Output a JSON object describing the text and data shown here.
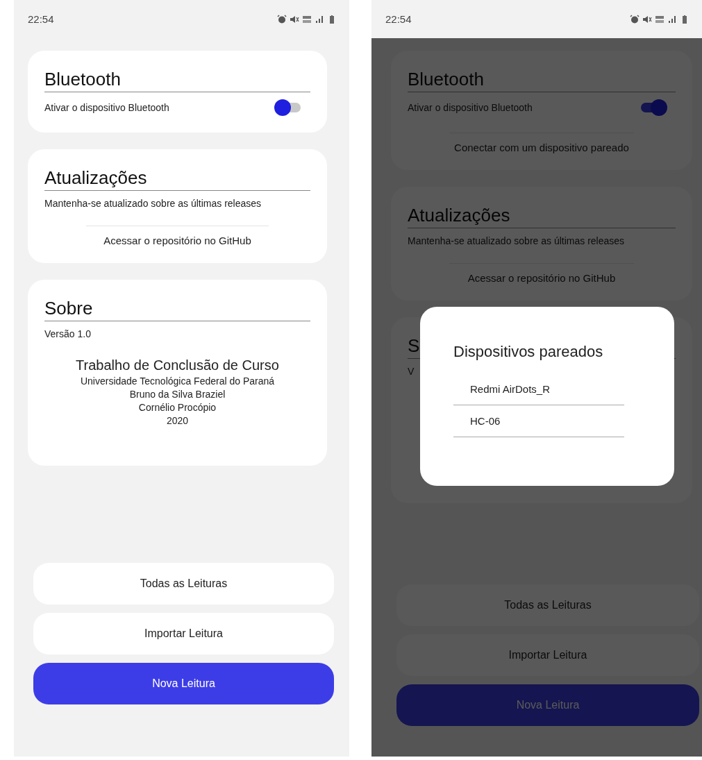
{
  "screens": [
    {
      "status_bar": {
        "time": "22:54"
      },
      "dimmed": false,
      "bluetooth": {
        "title": "Bluetooth",
        "label": "Ativar o dispositivo Bluetooth",
        "on": false
      },
      "updates": {
        "title": "Atualizações",
        "text": "Mantenha-se atualizado sobre as últimas releases",
        "link": "Acessar o repositório no GitHub"
      },
      "about": {
        "title": "Sobre",
        "version": "Versão 1.0",
        "credits": [
          "Trabalho de Conclusão de Curso",
          "Universidade Tecnológica Federal do Paraná",
          "Bruno da Silva Braziel",
          "Cornélio Procópio",
          "2020"
        ]
      },
      "buttons": [
        {
          "label": "Todas as Leituras",
          "primary": false
        },
        {
          "label": "Importar Leitura",
          "primary": false
        },
        {
          "label": "Nova Leitura",
          "primary": true
        }
      ]
    },
    {
      "status_bar": {
        "time": "22:54"
      },
      "dimmed": true,
      "bluetooth": {
        "title": "Bluetooth",
        "label": "Ativar o dispositivo Bluetooth",
        "on": true,
        "connect": "Conectar com um dispositivo pareado"
      },
      "updates": {
        "title": "Atualizações",
        "text": "Mantenha-se atualizado sobre as últimas releases",
        "link": "Acessar o repositório no GitHub"
      },
      "about": {
        "title": "S",
        "version": "V"
      },
      "buttons": [
        {
          "label": "Todas as Leituras",
          "primary": false
        },
        {
          "label": "Importar Leitura",
          "primary": false
        },
        {
          "label": "Nova Leitura",
          "primary": true
        }
      ],
      "dialog": {
        "title": "Dispositivos pareados",
        "items": [
          "Redmi AirDots_R",
          "HC-06"
        ]
      }
    }
  ]
}
